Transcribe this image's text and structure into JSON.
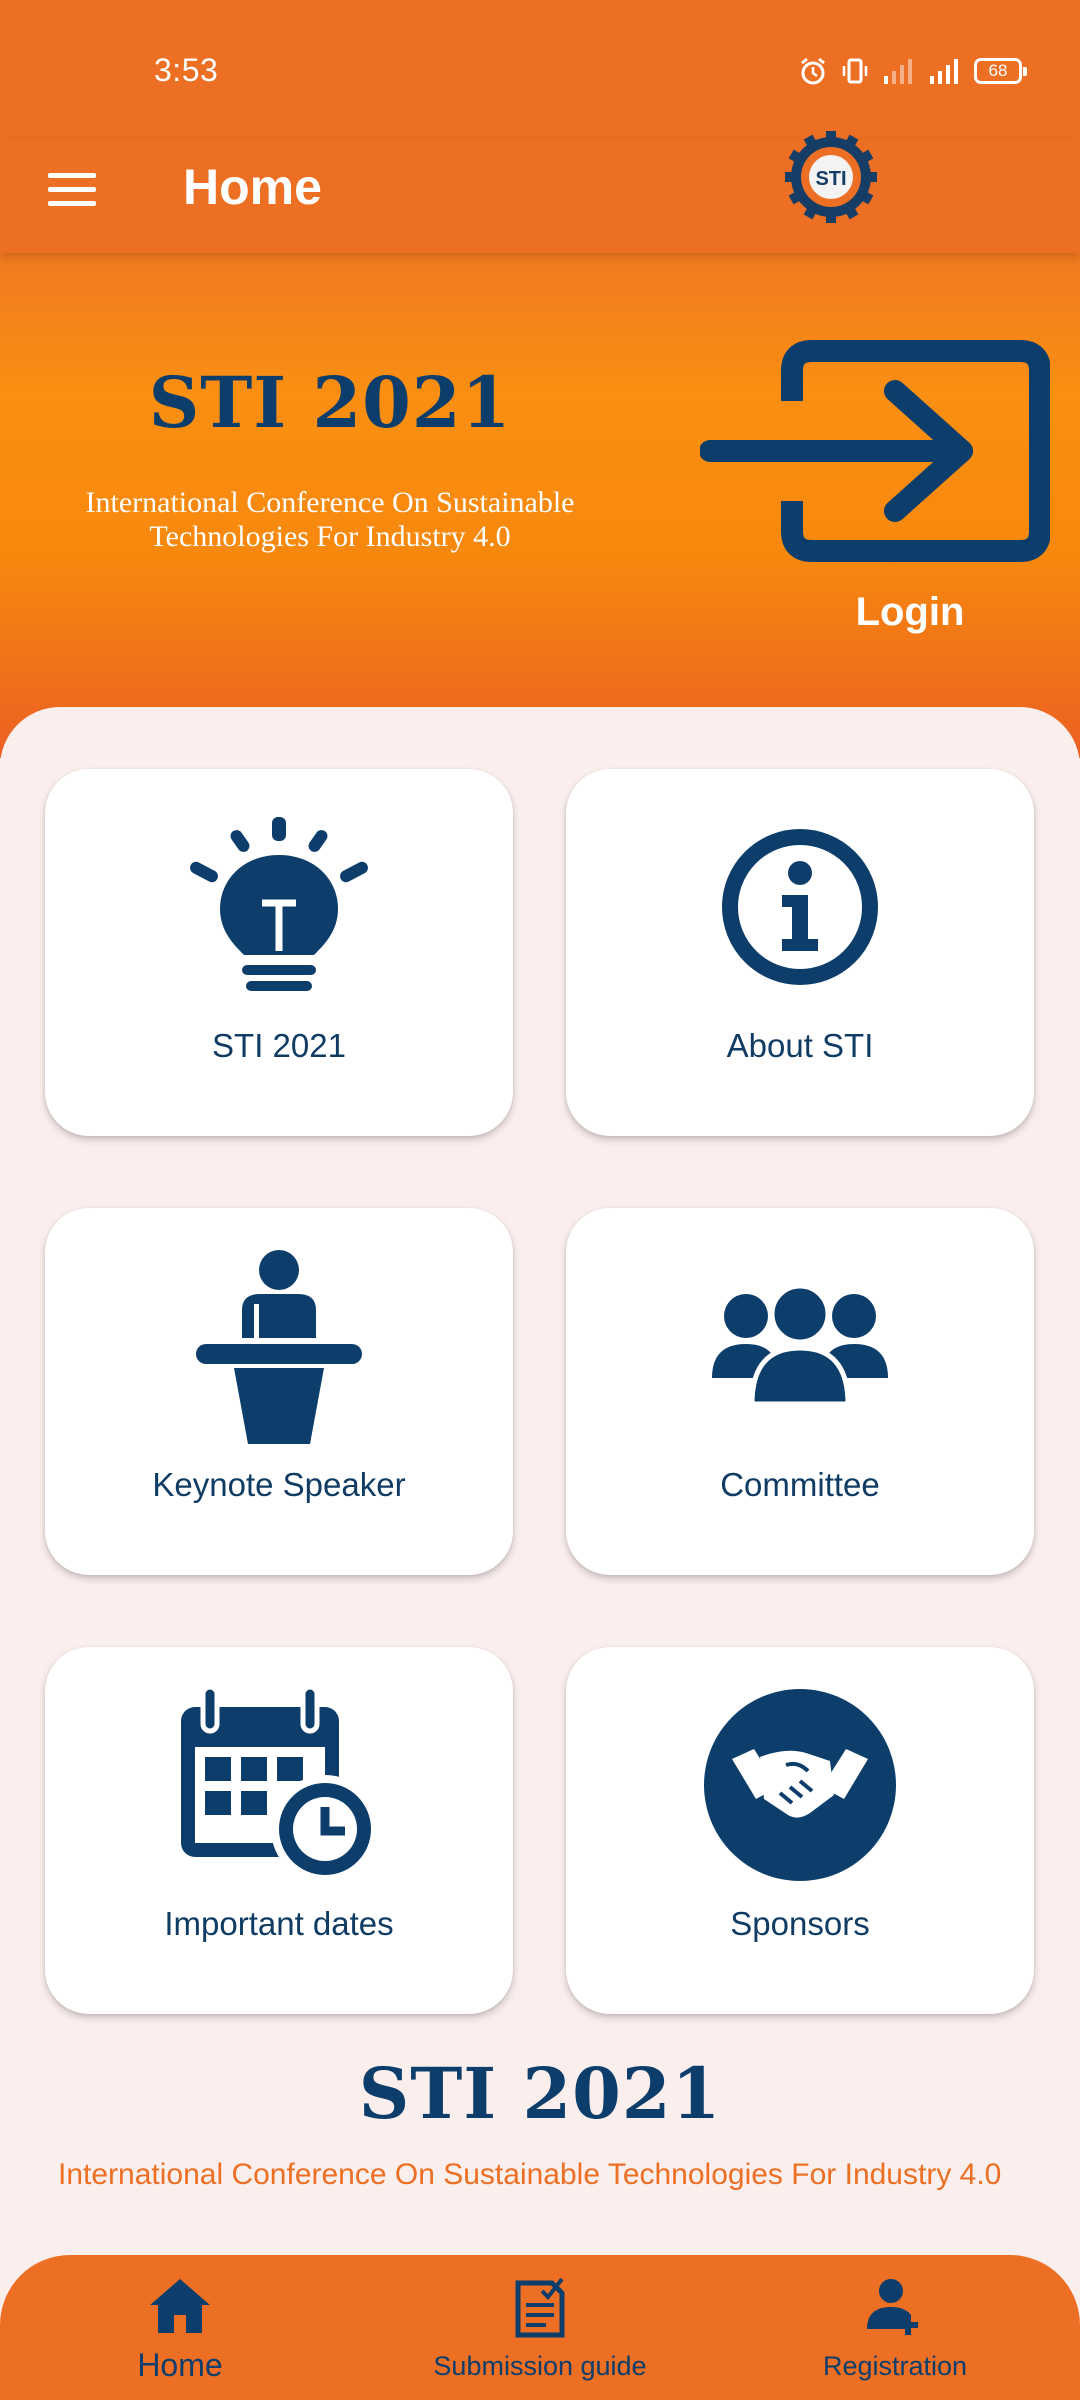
{
  "status_bar": {
    "time": "3:53",
    "icons": [
      "alarm-icon",
      "vibrate-icon",
      "signal-weak-icon",
      "signal-full-icon"
    ],
    "battery": "68"
  },
  "app_bar": {
    "title": "Home",
    "menu_icon": "hamburger-menu-icon",
    "logo_text": "STI"
  },
  "hero": {
    "title": "STI 2021",
    "subtitle_line1": "International Conference On Sustainable",
    "subtitle_line2": "Technologies For Industry 4.0",
    "login_label": "Login",
    "login_icon": "login-arrow-icon"
  },
  "cards": [
    {
      "label": "STI 2021",
      "icon": "lightbulb-icon"
    },
    {
      "label": "About STI",
      "icon": "info-icon"
    },
    {
      "label": "Keynote Speaker",
      "icon": "speaker-podium-icon"
    },
    {
      "label": "Committee",
      "icon": "group-icon"
    },
    {
      "label": "Important dates",
      "icon": "calendar-clock-icon"
    },
    {
      "label": "Sponsors",
      "icon": "handshake-icon"
    }
  ],
  "footer": {
    "title": "STI 2021",
    "subtitle": "International Conference On Sustainable Technologies For Industry 4.0"
  },
  "bottom_nav": {
    "items": [
      {
        "label": "Home",
        "icon": "home-icon"
      },
      {
        "label": "Submission guide",
        "icon": "document-check-icon"
      },
      {
        "label": "Registration",
        "icon": "add-user-icon"
      }
    ]
  },
  "colors": {
    "primary_orange": "#ec6f24",
    "navy": "#0d3e6b",
    "background": "#fbefee"
  }
}
